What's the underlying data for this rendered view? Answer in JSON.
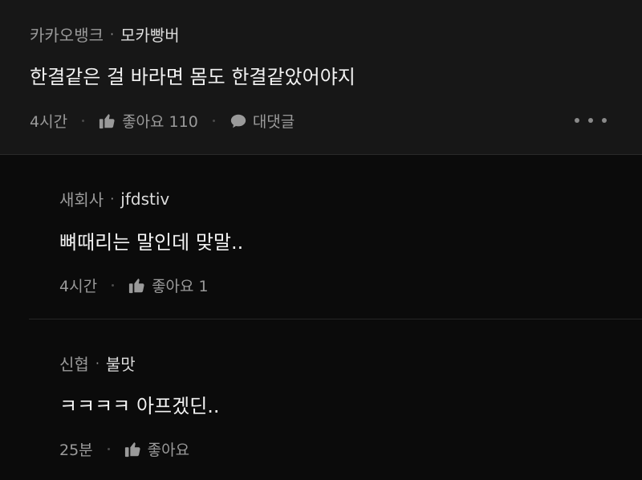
{
  "top_comment": {
    "company": "카카오뱅크",
    "nickname": "모카빵버",
    "text": "한결같은 걸 바라면 몸도 한결같았어야지",
    "time": "4시간",
    "like_label": "좋아요 110",
    "reply_label": "대댓글"
  },
  "replies": [
    {
      "company": "새회사",
      "nickname": "jfdstiv",
      "text": "뼈때리는 말인데 맞말..",
      "time": "4시간",
      "like_label": "좋아요 1"
    },
    {
      "company": "신협",
      "nickname": "불맛",
      "text": "ㅋㅋㅋㅋ 아프겠딘..",
      "time": "25분",
      "like_label": "좋아요"
    }
  ],
  "separator": "·"
}
